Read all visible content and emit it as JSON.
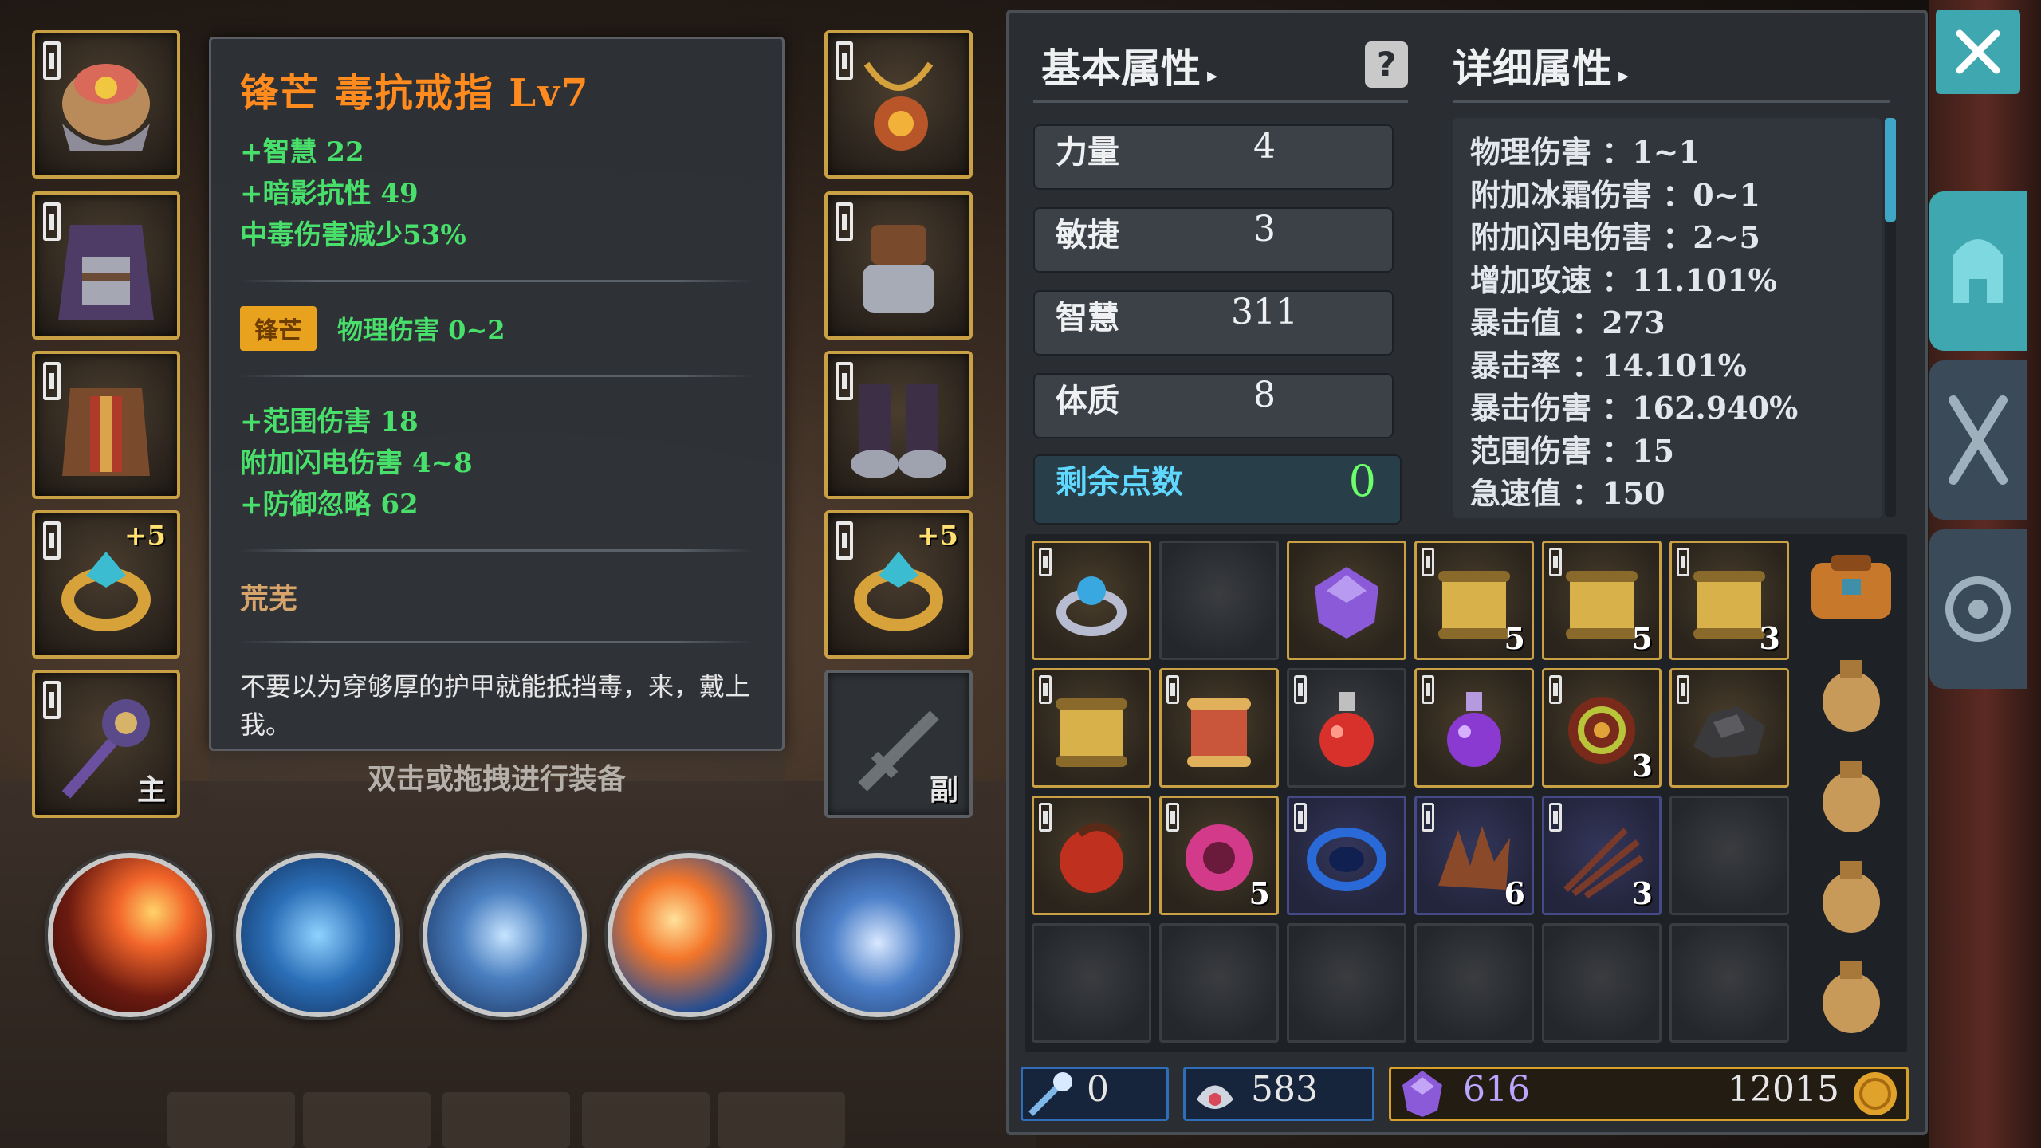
{
  "tooltip": {
    "title": "锋芒  毒抗戒指  Lv7",
    "base_stats": [
      "+智慧  22",
      "+暗影抗性  49",
      "中毒伤害减少53%"
    ],
    "affix_badge": "锋芒",
    "affix_text": "物理伤害  0~2",
    "extra_stats": [
      "+范围伤害  18",
      "附加闪电伤害  4~8",
      "+防御忽略  62"
    ],
    "flavor_name": "荒芜",
    "description": "不要以为穿够厚的护甲就能抵挡毒，来，戴上我。",
    "hint": "双击或拖拽进行装备"
  },
  "equipment": {
    "left_ring_plus": "+5",
    "right_ring_plus": "+5",
    "main_weapon_tag": "主",
    "offhand_tag": "副"
  },
  "basic_attrs": {
    "header": "基本属性",
    "stats": [
      {
        "label": "力量",
        "value": "4"
      },
      {
        "label": "敏捷",
        "value": "3"
      },
      {
        "label": "智慧",
        "value": "311"
      },
      {
        "label": "体质",
        "value": "8"
      }
    ],
    "points_label": "剩余点数",
    "points_value": "0"
  },
  "detail_attrs": {
    "header": "详细属性",
    "lines": [
      "物理伤害 ：1~1",
      "附加冰霜伤害 ：0~1",
      "附加闪电伤害 ：2~5",
      "增加攻速 ：11.101%",
      "暴击值 ：273",
      "暴击率 ：14.101%",
      "暴击伤害 ：162.940%",
      "范围伤害 ：15",
      "急速值 ：150"
    ]
  },
  "inventory": {
    "counts": {
      "r0c3": "5",
      "r0c4": "5",
      "r0c5": "3",
      "r1c4": "3",
      "r2c1": "5",
      "r2c3": "6",
      "r2c4": "3"
    }
  },
  "currency": {
    "wand_count": "0",
    "soul_count": "583",
    "gem_count": "616",
    "gold_count": "12015"
  },
  "colors": {
    "title_orange": "#ff8a1e",
    "stat_green": "#48e06a",
    "badge_gold": "#e8a21e",
    "accent_teal": "#3fa7b0",
    "points_green": "#6cff6a"
  }
}
